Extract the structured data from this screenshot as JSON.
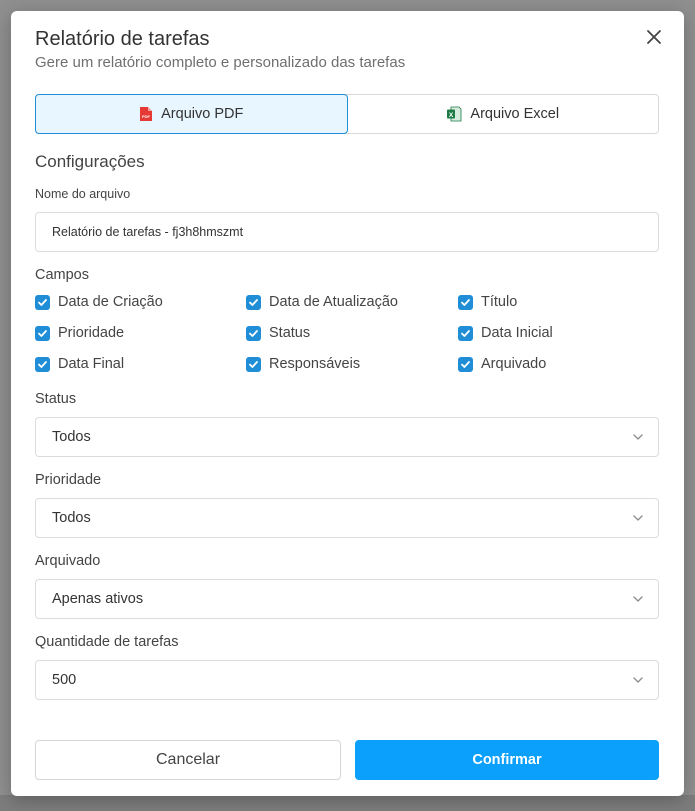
{
  "modal": {
    "title": "Relatório de tarefas",
    "subtitle": "Gere um relatório completo e personalizado das tarefas"
  },
  "tabs": [
    {
      "label": "Arquivo PDF",
      "icon": "pdf-file-icon",
      "active": true,
      "icon_text": "PDF"
    },
    {
      "label": "Arquivo Excel",
      "icon": "excel-file-icon",
      "active": false,
      "icon_text": "X"
    }
  ],
  "config": {
    "section_title": "Configurações",
    "filename_label": "Nome do arquivo",
    "filename_value": "Relatório de tarefas - fj3h8hmszmt"
  },
  "fields": {
    "label": "Campos",
    "items": [
      {
        "label": "Data de Criação",
        "checked": true
      },
      {
        "label": "Data de Atualização",
        "checked": true
      },
      {
        "label": "Título",
        "checked": true
      },
      {
        "label": "Prioridade",
        "checked": true
      },
      {
        "label": "Status",
        "checked": true
      },
      {
        "label": "Data Inicial",
        "checked": true
      },
      {
        "label": "Data Final",
        "checked": true
      },
      {
        "label": "Responsáveis",
        "checked": true
      },
      {
        "label": "Arquivado",
        "checked": true
      }
    ]
  },
  "filters": {
    "status": {
      "label": "Status",
      "value": "Todos"
    },
    "priority": {
      "label": "Prioridade",
      "value": "Todos"
    },
    "archived": {
      "label": "Arquivado",
      "value": "Apenas ativos"
    },
    "quantity": {
      "label": "Quantidade de tarefas",
      "value": "500"
    }
  },
  "actions": {
    "cancel_label": "Cancelar",
    "confirm_label": "Confirmar"
  },
  "colors": {
    "accent": "#1f8ed6",
    "primary_button": "#0aa0fb",
    "active_tab_bg": "#e8f6ff",
    "pdf_red": "#e53935",
    "excel_green": "#1e7b45"
  }
}
